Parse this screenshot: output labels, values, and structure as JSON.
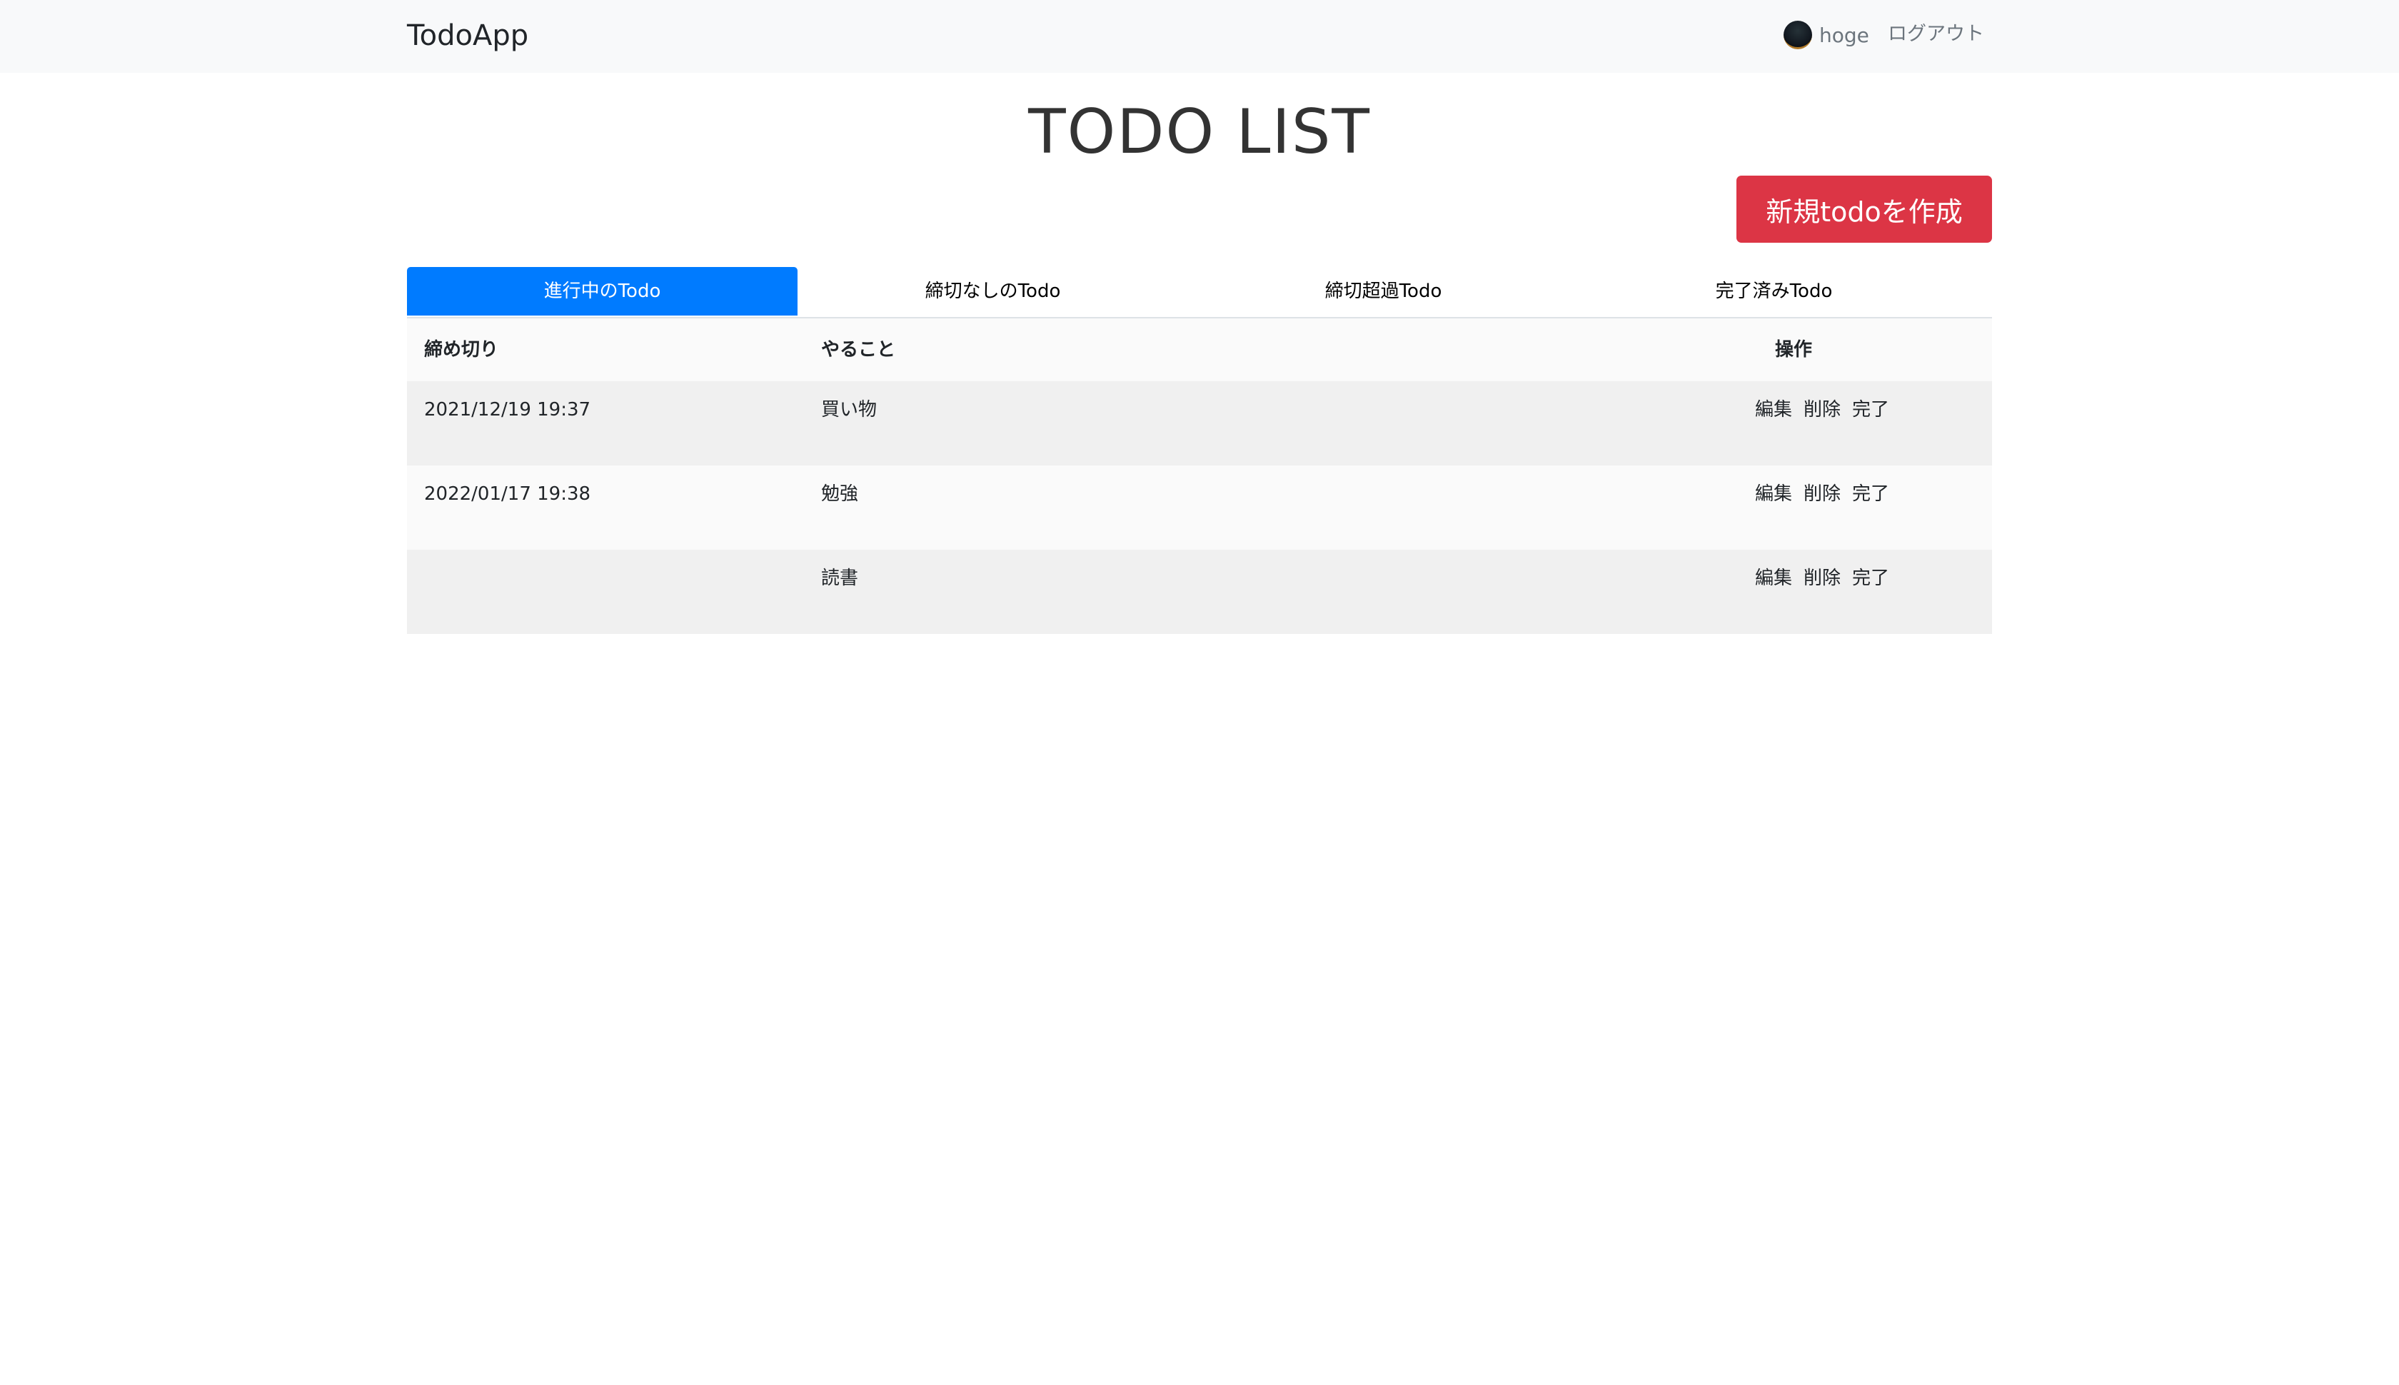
{
  "navbar": {
    "brand": "TodoApp",
    "username": "hoge",
    "logout": "ログアウト"
  },
  "page": {
    "title": "TODO LIST",
    "new_button": "新規todoを作成"
  },
  "tabs": [
    {
      "label": "進行中のTodo",
      "active": true
    },
    {
      "label": "締切なしのTodo",
      "active": false
    },
    {
      "label": "締切超過Todo",
      "active": false
    },
    {
      "label": "完了済みTodo",
      "active": false
    }
  ],
  "table": {
    "headers": {
      "deadline": "締め切り",
      "task": "やること",
      "operations": "操作"
    },
    "rows": [
      {
        "deadline": "2021/12/19 19:37",
        "task": "買い物",
        "edit": "編集",
        "delete": "削除",
        "done": "完了"
      },
      {
        "deadline": "2022/01/17 19:38",
        "task": "勉強",
        "edit": "編集",
        "delete": "削除",
        "done": "完了"
      },
      {
        "deadline": "",
        "task": "読書",
        "edit": "編集",
        "delete": "削除",
        "done": "完了"
      }
    ]
  },
  "colors": {
    "primary": "#007bff",
    "danger": "#dc3545",
    "navbar_bg": "#f8f9fa",
    "muted_text": "#6c757d"
  }
}
